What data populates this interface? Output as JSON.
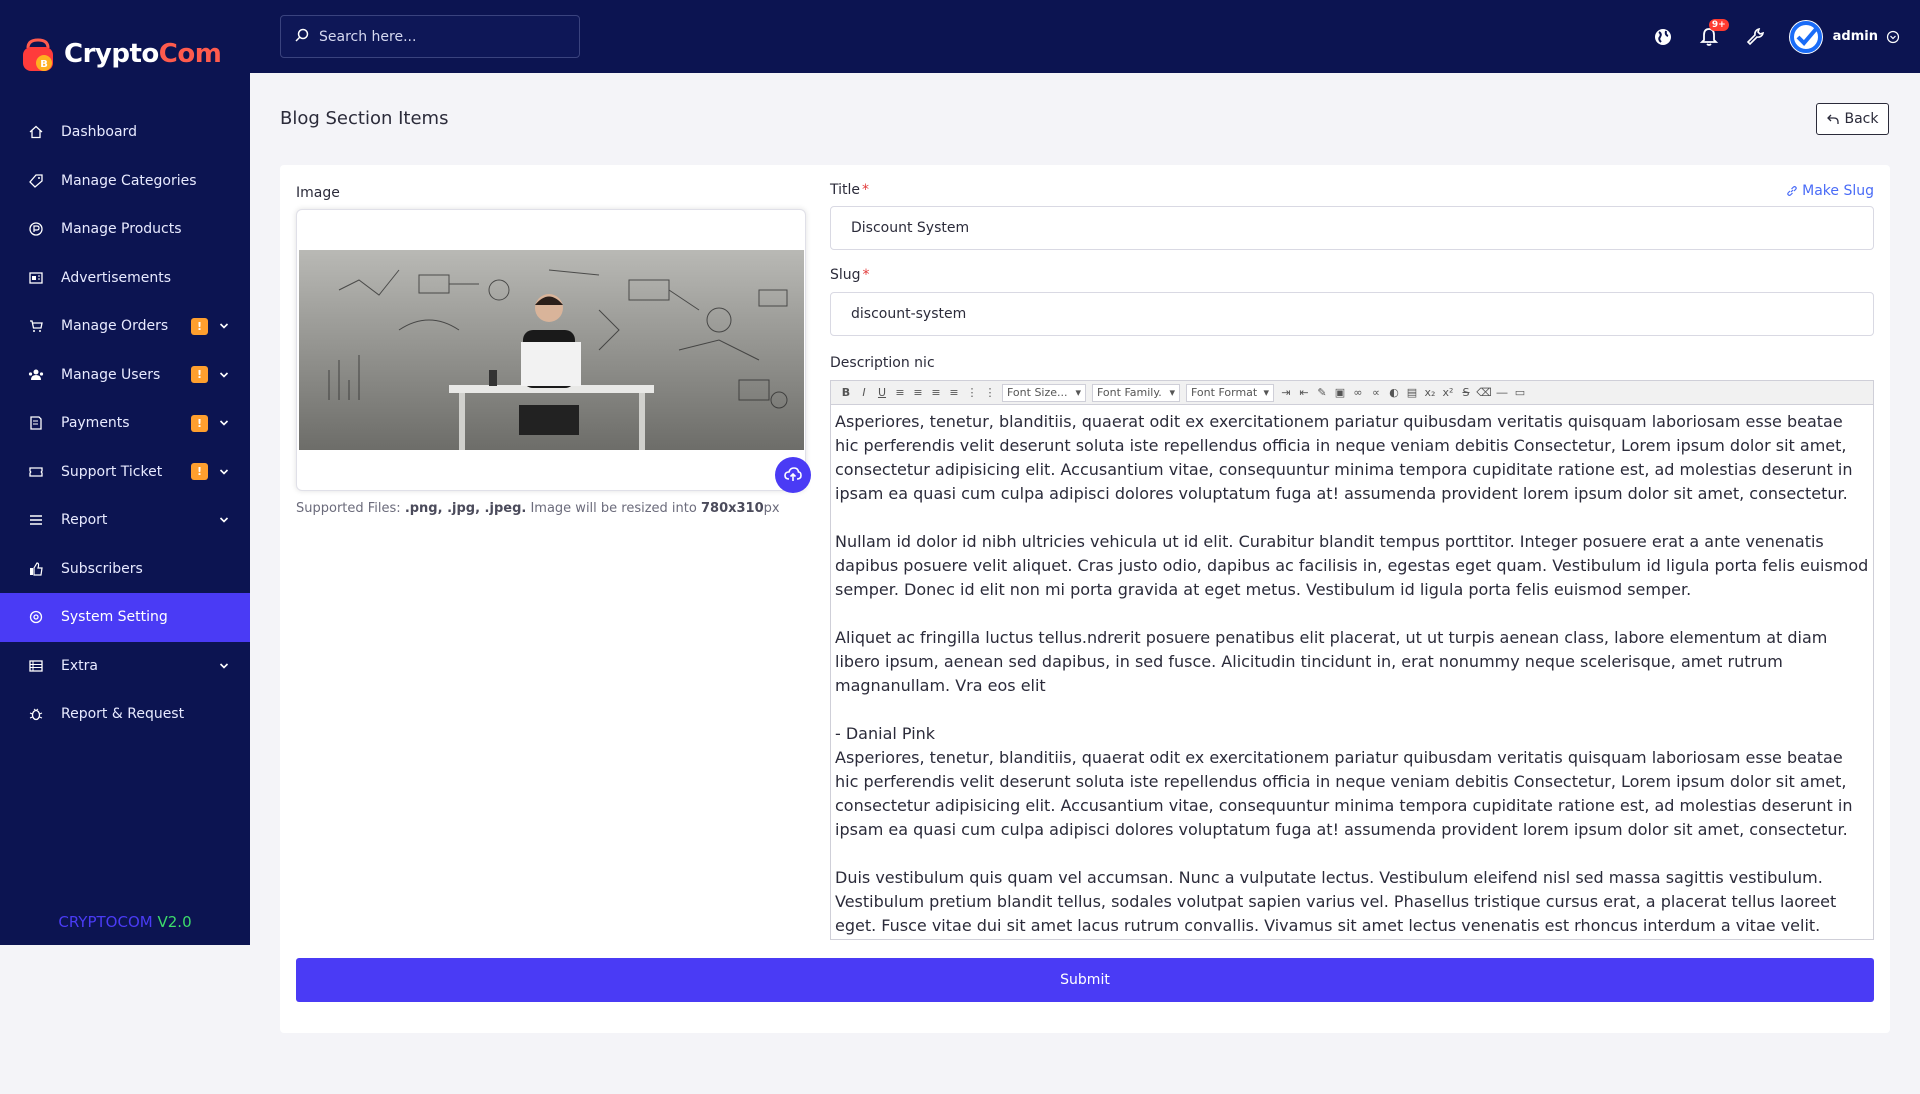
{
  "brand": {
    "part1": "Crypto",
    "part2": "Com"
  },
  "search": {
    "placeholder": "Search here..."
  },
  "topbar": {
    "notification_count": "9+",
    "username": "admin"
  },
  "sidebar": {
    "items": [
      {
        "label": "Dashboard",
        "icon": "home-icon"
      },
      {
        "label": "Manage Categories",
        "icon": "tag-icon"
      },
      {
        "label": "Manage Products",
        "icon": "product-icon"
      },
      {
        "label": "Advertisements",
        "icon": "ad-icon"
      },
      {
        "label": "Manage Orders",
        "icon": "cart-icon",
        "badge": "!"
      },
      {
        "label": "Manage Users",
        "icon": "users-icon",
        "badge": "!"
      },
      {
        "label": "Payments",
        "icon": "payment-icon",
        "badge": "!"
      },
      {
        "label": "Support Ticket",
        "icon": "ticket-icon",
        "badge": "!"
      },
      {
        "label": "Report",
        "icon": "list-icon"
      },
      {
        "label": "Subscribers",
        "icon": "thumbs-up-icon"
      },
      {
        "label": "System Setting",
        "icon": "gear-icon",
        "active": true
      },
      {
        "label": "Extra",
        "icon": "layers-icon"
      },
      {
        "label": "Report & Request",
        "icon": "bug-icon"
      }
    ],
    "version_name": "CRYPTOCOM",
    "version_number": "V2.0"
  },
  "page": {
    "title": "Blog Section Items",
    "back_label": "Back"
  },
  "form": {
    "image_label": "Image",
    "help_prefix": "Supported Files: ",
    "help_types": ".png, .jpg, .jpeg.",
    "help_middle": " Image will be resized into ",
    "help_size": "780x310",
    "help_unit": "px",
    "title_label": "Title",
    "title_required": "*",
    "title_value": "Discount System",
    "make_slug_label": "Make Slug",
    "slug_label": "Slug",
    "slug_required": "*",
    "slug_value": "discount-system",
    "description_label": "Description nic",
    "toolbar": {
      "font_size": "Font Size...",
      "font_family": "Font Family.",
      "font_format": "Font Format"
    },
    "description_paragraphs": [
      "Asperiores, tenetur, blanditiis, quaerat odit ex exercitationem pariatur quibusdam veritatis quisquam laboriosam esse beatae hic perferendis velit deserunt soluta iste repellendus officia in neque veniam debitis Consectetur, Lorem ipsum dolor sit amet, consectetur adipisicing elit. Accusantium vitae, consequuntur minima tempora cupiditate ratione est, ad molestias deserunt in ipsam ea quasi cum culpa adipisci dolores voluptatum fuga at! assumenda provident lorem ipsum dolor sit amet, consectetur.",
      "Nullam id dolor id nibh ultricies vehicula ut id elit. Curabitur blandit tempus porttitor. Integer posuere erat a ante venenatis dapibus posuere velit aliquet. Cras justo odio, dapibus ac facilisis in, egestas eget quam. Vestibulum id ligula porta felis euismod semper. Donec id elit non mi porta gravida at eget metus. Vestibulum id ligula porta felis euismod semper.",
      "Aliquet ac fringilla luctus tellus.ndrerit posuere penatibus elit placerat, ut ut turpis aenean class, labore elementum at diam libero ipsum, aenean sed dapibus, in sed fusce. Alicitudin tincidunt in, erat nonummy neque scelerisque, amet rutrum magnanullam. Vra eos elit",
      "- Danial Pink",
      "Asperiores, tenetur, blanditiis, quaerat odit ex exercitationem pariatur quibusdam veritatis quisquam laboriosam esse beatae hic perferendis velit deserunt soluta iste repellendus officia in neque veniam debitis Consectetur, Lorem ipsum dolor sit amet, consectetur adipisicing elit. Accusantium vitae, consequuntur minima tempora cupiditate ratione est, ad molestias deserunt in ipsam ea quasi cum culpa adipisci dolores voluptatum fuga at! assumenda provident lorem ipsum dolor sit amet, consectetur.",
      "Duis vestibulum quis quam vel accumsan. Nunc a vulputate lectus. Vestibulum eleifend nisl sed massa sagittis vestibulum. Vestibulum pretium blandit tellus, sodales volutpat sapien varius vel. Phasellus tristique cursus erat, a placerat tellus laoreet eget. Fusce vitae dui sit amet lacus rutrum convallis. Vivamus sit amet lectus venenatis est rhoncus interdum a vitae velit."
    ],
    "submit_label": "Submit"
  },
  "colors": {
    "sidebar_bg": "#0c1451",
    "accent": "#4a3bf5",
    "badge": "#ff9f2e",
    "brand_red": "#ff5b4d"
  }
}
